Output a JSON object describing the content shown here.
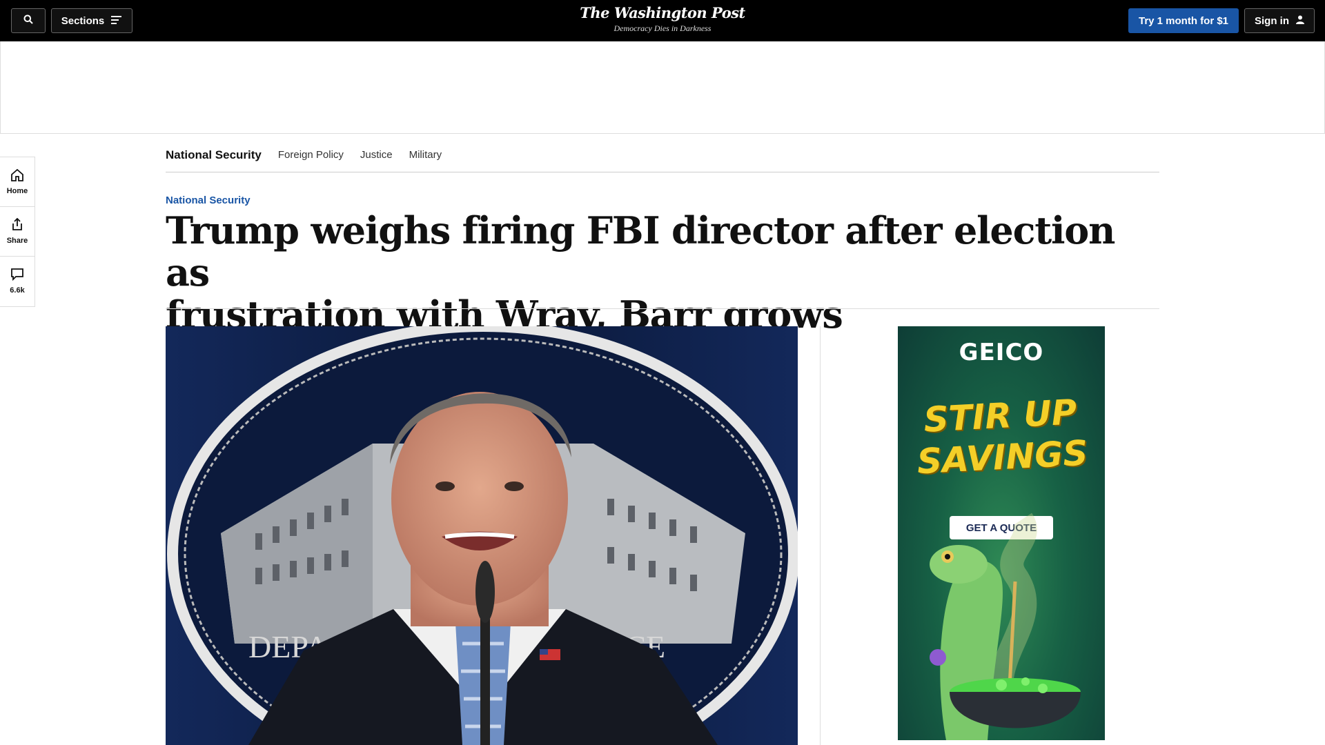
{
  "header": {
    "sections_label": "Sections",
    "logo_name": "The Washington Post",
    "logo_tagline": "Democracy Dies in Darkness",
    "subscribe_label": "Try 1 month for $1",
    "signin_label": "Sign in",
    "accent": "#1955a5"
  },
  "rail": {
    "home_label": "Home",
    "share_label": "Share",
    "comments_count": "6.6k"
  },
  "section_nav": {
    "main": "National Security",
    "links": [
      "Foreign Policy",
      "Justice",
      "Military"
    ]
  },
  "article": {
    "kicker": "National Security",
    "headline_line1": "Trump weighs firing FBI director after election as",
    "headline_line2": "frustration with Wray, Barr grows"
  },
  "photo": {
    "seal_text_left": "DEPA",
    "seal_text_right": "ICE"
  },
  "side_ad": {
    "brand": "GEICO",
    "slogan_line1": "STIR UP",
    "slogan_line2": "SAVINGS",
    "cta": "GET A QUOTE"
  }
}
